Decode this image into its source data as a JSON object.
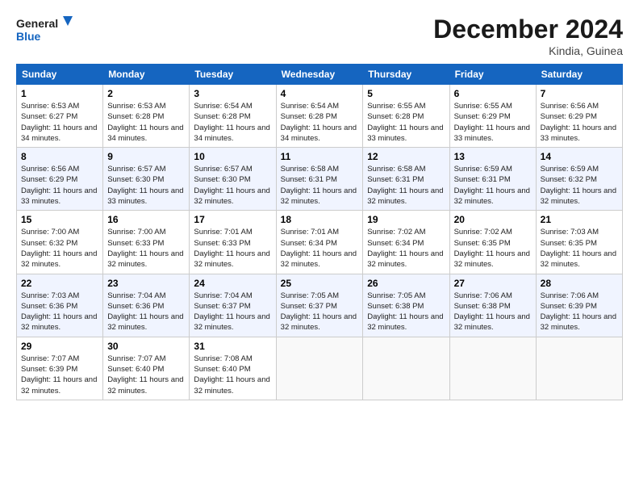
{
  "header": {
    "logo_line1": "General",
    "logo_line2": "Blue",
    "month": "December 2024",
    "location": "Kindia, Guinea"
  },
  "columns": [
    "Sunday",
    "Monday",
    "Tuesday",
    "Wednesday",
    "Thursday",
    "Friday",
    "Saturday"
  ],
  "weeks": [
    [
      {
        "day": "1",
        "sunrise": "6:53 AM",
        "sunset": "6:27 PM",
        "daylight": "11 hours and 34 minutes."
      },
      {
        "day": "2",
        "sunrise": "6:53 AM",
        "sunset": "6:28 PM",
        "daylight": "11 hours and 34 minutes."
      },
      {
        "day": "3",
        "sunrise": "6:54 AM",
        "sunset": "6:28 PM",
        "daylight": "11 hours and 34 minutes."
      },
      {
        "day": "4",
        "sunrise": "6:54 AM",
        "sunset": "6:28 PM",
        "daylight": "11 hours and 34 minutes."
      },
      {
        "day": "5",
        "sunrise": "6:55 AM",
        "sunset": "6:28 PM",
        "daylight": "11 hours and 33 minutes."
      },
      {
        "day": "6",
        "sunrise": "6:55 AM",
        "sunset": "6:29 PM",
        "daylight": "11 hours and 33 minutes."
      },
      {
        "day": "7",
        "sunrise": "6:56 AM",
        "sunset": "6:29 PM",
        "daylight": "11 hours and 33 minutes."
      }
    ],
    [
      {
        "day": "8",
        "sunrise": "6:56 AM",
        "sunset": "6:29 PM",
        "daylight": "11 hours and 33 minutes."
      },
      {
        "day": "9",
        "sunrise": "6:57 AM",
        "sunset": "6:30 PM",
        "daylight": "11 hours and 33 minutes."
      },
      {
        "day": "10",
        "sunrise": "6:57 AM",
        "sunset": "6:30 PM",
        "daylight": "11 hours and 32 minutes."
      },
      {
        "day": "11",
        "sunrise": "6:58 AM",
        "sunset": "6:31 PM",
        "daylight": "11 hours and 32 minutes."
      },
      {
        "day": "12",
        "sunrise": "6:58 AM",
        "sunset": "6:31 PM",
        "daylight": "11 hours and 32 minutes."
      },
      {
        "day": "13",
        "sunrise": "6:59 AM",
        "sunset": "6:31 PM",
        "daylight": "11 hours and 32 minutes."
      },
      {
        "day": "14",
        "sunrise": "6:59 AM",
        "sunset": "6:32 PM",
        "daylight": "11 hours and 32 minutes."
      }
    ],
    [
      {
        "day": "15",
        "sunrise": "7:00 AM",
        "sunset": "6:32 PM",
        "daylight": "11 hours and 32 minutes."
      },
      {
        "day": "16",
        "sunrise": "7:00 AM",
        "sunset": "6:33 PM",
        "daylight": "11 hours and 32 minutes."
      },
      {
        "day": "17",
        "sunrise": "7:01 AM",
        "sunset": "6:33 PM",
        "daylight": "11 hours and 32 minutes."
      },
      {
        "day": "18",
        "sunrise": "7:01 AM",
        "sunset": "6:34 PM",
        "daylight": "11 hours and 32 minutes."
      },
      {
        "day": "19",
        "sunrise": "7:02 AM",
        "sunset": "6:34 PM",
        "daylight": "11 hours and 32 minutes."
      },
      {
        "day": "20",
        "sunrise": "7:02 AM",
        "sunset": "6:35 PM",
        "daylight": "11 hours and 32 minutes."
      },
      {
        "day": "21",
        "sunrise": "7:03 AM",
        "sunset": "6:35 PM",
        "daylight": "11 hours and 32 minutes."
      }
    ],
    [
      {
        "day": "22",
        "sunrise": "7:03 AM",
        "sunset": "6:36 PM",
        "daylight": "11 hours and 32 minutes."
      },
      {
        "day": "23",
        "sunrise": "7:04 AM",
        "sunset": "6:36 PM",
        "daylight": "11 hours and 32 minutes."
      },
      {
        "day": "24",
        "sunrise": "7:04 AM",
        "sunset": "6:37 PM",
        "daylight": "11 hours and 32 minutes."
      },
      {
        "day": "25",
        "sunrise": "7:05 AM",
        "sunset": "6:37 PM",
        "daylight": "11 hours and 32 minutes."
      },
      {
        "day": "26",
        "sunrise": "7:05 AM",
        "sunset": "6:38 PM",
        "daylight": "11 hours and 32 minutes."
      },
      {
        "day": "27",
        "sunrise": "7:06 AM",
        "sunset": "6:38 PM",
        "daylight": "11 hours and 32 minutes."
      },
      {
        "day": "28",
        "sunrise": "7:06 AM",
        "sunset": "6:39 PM",
        "daylight": "11 hours and 32 minutes."
      }
    ],
    [
      {
        "day": "29",
        "sunrise": "7:07 AM",
        "sunset": "6:39 PM",
        "daylight": "11 hours and 32 minutes."
      },
      {
        "day": "30",
        "sunrise": "7:07 AM",
        "sunset": "6:40 PM",
        "daylight": "11 hours and 32 minutes."
      },
      {
        "day": "31",
        "sunrise": "7:08 AM",
        "sunset": "6:40 PM",
        "daylight": "11 hours and 32 minutes."
      },
      null,
      null,
      null,
      null
    ]
  ]
}
